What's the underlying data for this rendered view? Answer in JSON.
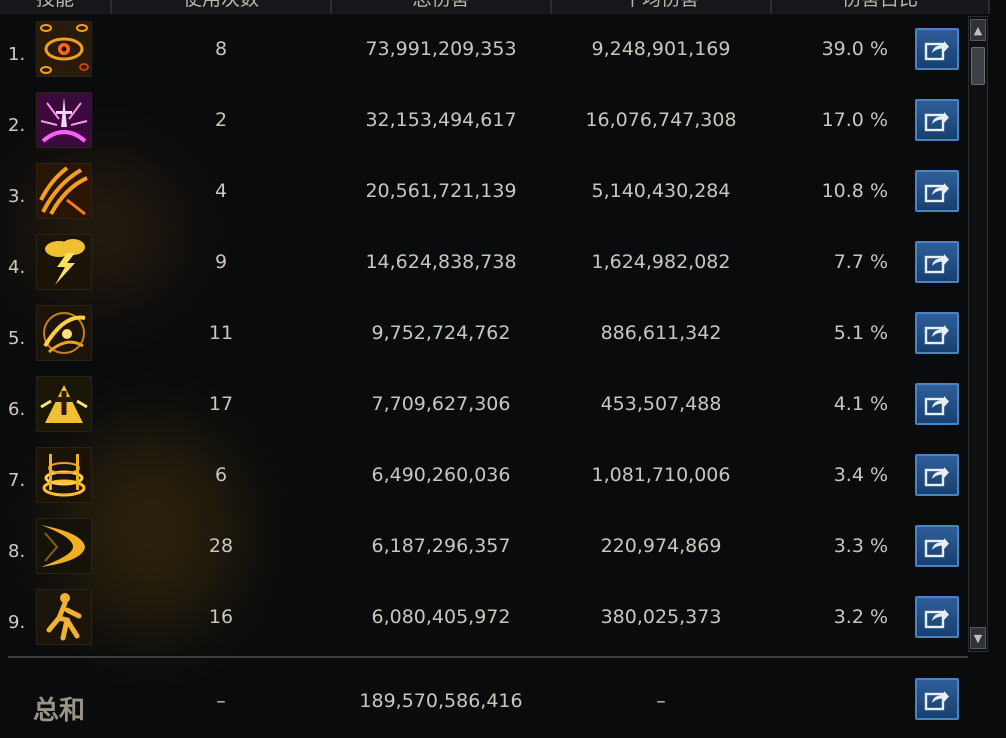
{
  "header": {
    "col_skill": "技能",
    "col_uses": "使用次数",
    "col_total": "总伤害",
    "col_avg": "平均伤害",
    "col_pct": "伤害占比"
  },
  "rows": [
    {
      "rank": "1.",
      "icon": "eye-skill-icon",
      "uses": "8",
      "total": "73,991,209,353",
      "avg": "9,248,901,169",
      "pct": "39.0 %"
    },
    {
      "rank": "2.",
      "icon": "sword-burst-skill-icon",
      "uses": "2",
      "total": "32,153,494,617",
      "avg": "16,076,747,308",
      "pct": "17.0 %"
    },
    {
      "rank": "3.",
      "icon": "claw-slash-skill-icon",
      "uses": "4",
      "total": "20,561,721,139",
      "avg": "5,140,430,284",
      "pct": "10.8 %"
    },
    {
      "rank": "4.",
      "icon": "lightning-cloud-skill-icon",
      "uses": "9",
      "total": "14,624,838,738",
      "avg": "1,624,982,082",
      "pct": "7.7 %"
    },
    {
      "rank": "5.",
      "icon": "swirl-slash-skill-icon",
      "uses": "11",
      "total": "9,752,724,762",
      "avg": "886,611,342",
      "pct": "5.1 %"
    },
    {
      "rank": "6.",
      "icon": "holy-cross-skill-icon",
      "uses": "17",
      "total": "7,709,627,306",
      "avg": "453,507,488",
      "pct": "4.1 %"
    },
    {
      "rank": "7.",
      "icon": "ring-pillar-skill-icon",
      "uses": "6",
      "total": "6,490,260,036",
      "avg": "1,081,710,006",
      "pct": "3.4 %"
    },
    {
      "rank": "8.",
      "icon": "crescent-wave-skill-icon",
      "uses": "28",
      "total": "6,187,296,357",
      "avg": "220,974,869",
      "pct": "3.3 %"
    },
    {
      "rank": "9.",
      "icon": "figure-dash-skill-icon",
      "uses": "16",
      "total": "6,080,405,972",
      "avg": "380,025,373",
      "pct": "3.2 %"
    }
  ],
  "total": {
    "label": "总和",
    "uses": "–",
    "total": "189,570,586,416",
    "avg": "–"
  },
  "colors": {
    "gold": "#f0b020",
    "share_button": "#2e5e9a"
  }
}
